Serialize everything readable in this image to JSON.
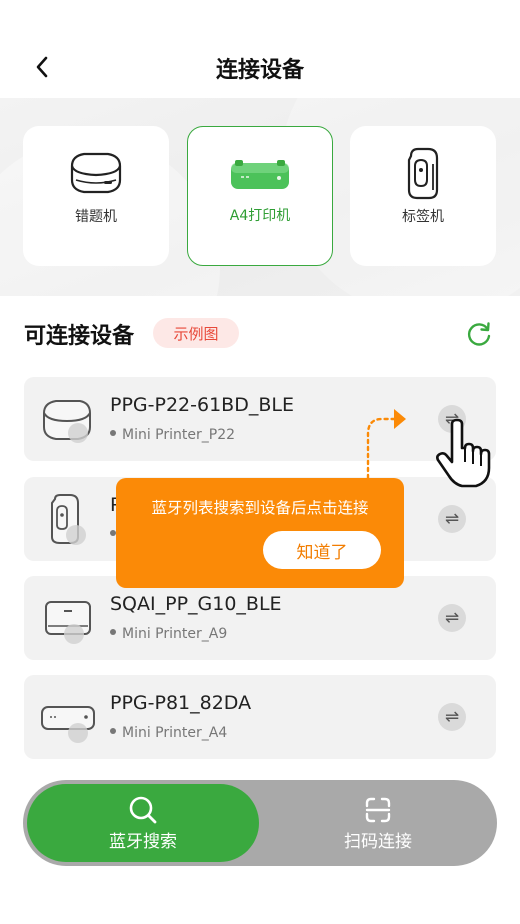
{
  "header": {
    "title": "连接设备",
    "back_icon": "chevron-left-icon"
  },
  "device_types": [
    {
      "label": "错题机",
      "icon": "mistake-printer-icon",
      "selected": false
    },
    {
      "label": "A4打印机",
      "icon": "a4-printer-icon",
      "selected": true
    },
    {
      "label": "标签机",
      "icon": "label-printer-icon",
      "selected": false
    }
  ],
  "list": {
    "title": "可连接设备",
    "sample_badge": "示例图",
    "refresh_icon": "refresh-icon",
    "devices": [
      {
        "name": "PPG-P22-61BD_BLE",
        "model": "Mini Printer_P22",
        "icon": "mini-printer-icon"
      },
      {
        "name": "P",
        "model": "",
        "icon": "label-printer-icon"
      },
      {
        "name": "SQAI_PP_G10_BLE",
        "model": "Mini Printer_A9",
        "icon": "box-printer-icon"
      },
      {
        "name": "PPG-P81_82DA",
        "model": "Mini Printer_A4",
        "icon": "a4-printer-icon"
      }
    ],
    "connect_icon": "connect-swap-icon"
  },
  "tooltip": {
    "text": "蓝牙列表搜索到设备后点击连接",
    "button": "知道了"
  },
  "bottom_bar": {
    "bluetooth_search": "蓝牙搜索",
    "scan_connect": "扫码连接",
    "active": "bluetooth_search"
  },
  "colors": {
    "primary_green": "#3aa93f",
    "orange": "#fb8a07",
    "badge_red": "#e8493a"
  }
}
